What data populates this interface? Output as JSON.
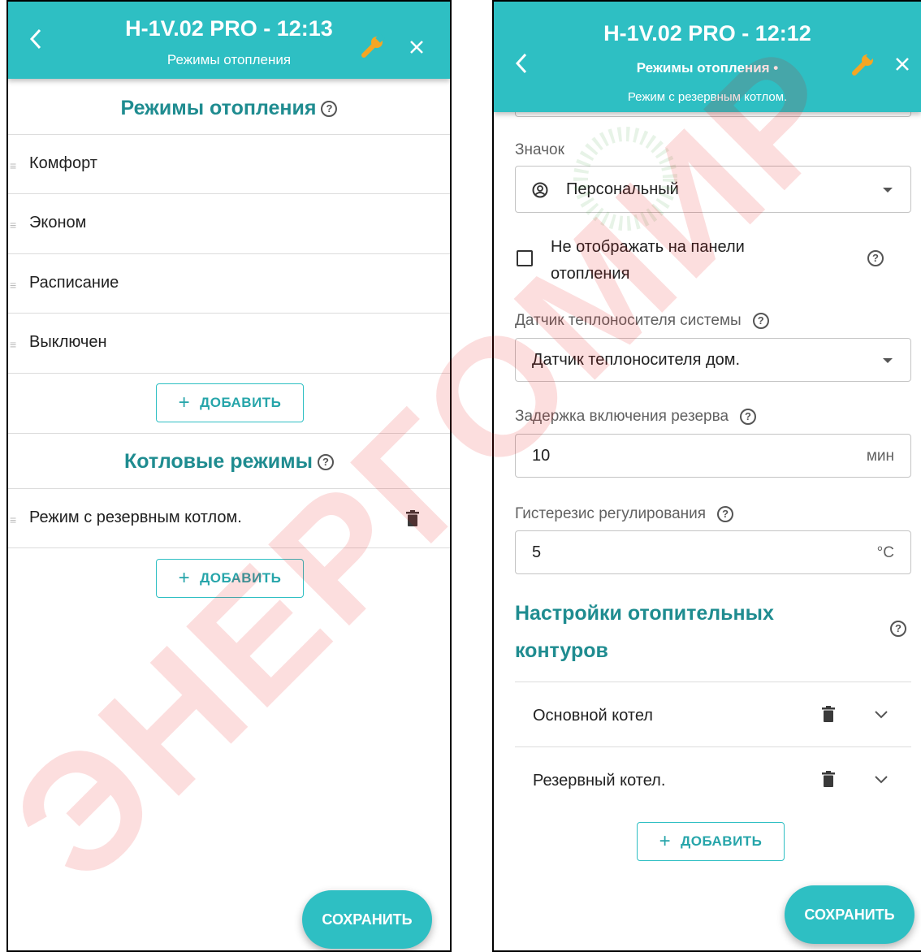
{
  "left": {
    "header": {
      "title": "H-1V.02 PRO - 12:13",
      "subtitle": "Режимы отопления"
    },
    "heating_modes": {
      "title": "Режимы отопления",
      "items": [
        "Комфорт",
        "Эконом",
        "Расписание",
        "Выключен"
      ],
      "add_label": "ДОБАВИТЬ"
    },
    "boiler_modes": {
      "title": "Котловые режимы",
      "items": [
        "Режим с резервным котлом."
      ],
      "add_label": "ДОБАВИТЬ"
    },
    "save_label": "СОХРАНИТЬ"
  },
  "right": {
    "header": {
      "title": "H-1V.02 PRO - 12:12",
      "subtitle": "Режимы отопления",
      "subsubtitle": "Режим с резервным котлом."
    },
    "icon_field": {
      "label": "Значок",
      "value": "Персональный"
    },
    "hide_checkbox": {
      "label": "Не отображать на панели отопления",
      "checked": false
    },
    "sensor_field": {
      "label": "Датчик теплоносителя системы",
      "value": "Датчик теплоносителя дом."
    },
    "delay_field": {
      "label": "Задержка включения резерва",
      "value": "10",
      "unit": "мин"
    },
    "hysteresis_field": {
      "label": "Гистерезис регулирования",
      "value": "5",
      "unit": "°C"
    },
    "circuits": {
      "title": "Настройки отопительных контуров",
      "items": [
        "Основной котел",
        "Резервный котел."
      ],
      "add_label": "ДОБАВИТЬ"
    },
    "save_label": "СОХРАНИТЬ"
  },
  "watermark": "ЭНЕРГОМИР",
  "colors": {
    "accent": "#2ebfc3",
    "accent_text": "#1f8c90",
    "watermark": "#e60000"
  }
}
